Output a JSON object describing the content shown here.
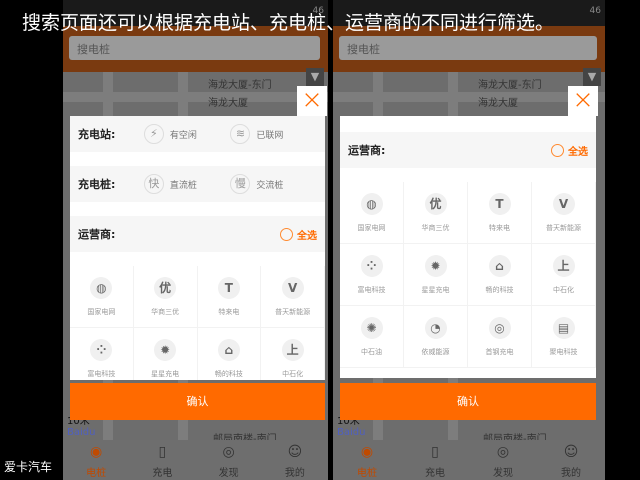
{
  "caption": "搜索页面还可以根据充电站、充电桩、运营商的不同进行筛选。",
  "watermark": "爱卡汽车",
  "search_placeholder": "搜电桩",
  "status_signal": "46",
  "map_labels": {
    "poi1": "海龙大厦-东门",
    "poi2": "海龙大厦",
    "scale": "10米",
    "poi3": "邮局南楼-南门",
    "baidu": "Baidu"
  },
  "filter": {
    "station_label": "充电站:",
    "station_options": [
      {
        "icon": "⚡",
        "label": "有空闲"
      },
      {
        "icon": "≋",
        "label": "已联网"
      }
    ],
    "pile_label": "充电桩:",
    "pile_options": [
      {
        "icon": "快",
        "label": "直流桩"
      },
      {
        "icon": "慢",
        "label": "交流桩"
      }
    ],
    "operator_label": "运营商:",
    "select_all": "全选",
    "operators": [
      {
        "logo": "◍",
        "name": "国家电网"
      },
      {
        "logo": "优",
        "name": "华商三优"
      },
      {
        "logo": "T",
        "name": "特来电"
      },
      {
        "logo": "V",
        "name": "普天新能源"
      },
      {
        "logo": "⁘",
        "name": "富电科技"
      },
      {
        "logo": "✹",
        "name": "星星充电"
      },
      {
        "logo": "⌂",
        "name": "畅的科技"
      },
      {
        "logo": "上",
        "name": "中石化"
      },
      {
        "logo": "✺",
        "name": "中石油"
      },
      {
        "logo": "◔",
        "name": "依威能源"
      },
      {
        "logo": "◎",
        "name": "首钢充电"
      },
      {
        "logo": "▤",
        "name": "聚电科技"
      }
    ],
    "confirm": "确认",
    "close_icon": "×"
  },
  "nav": [
    {
      "icon": "◉",
      "label": "电桩",
      "active": true
    },
    {
      "icon": "▯",
      "label": "充电"
    },
    {
      "icon": "◎",
      "label": "发现"
    },
    {
      "icon": "☺",
      "label": "我的"
    }
  ],
  "accent": "#ff6a00"
}
